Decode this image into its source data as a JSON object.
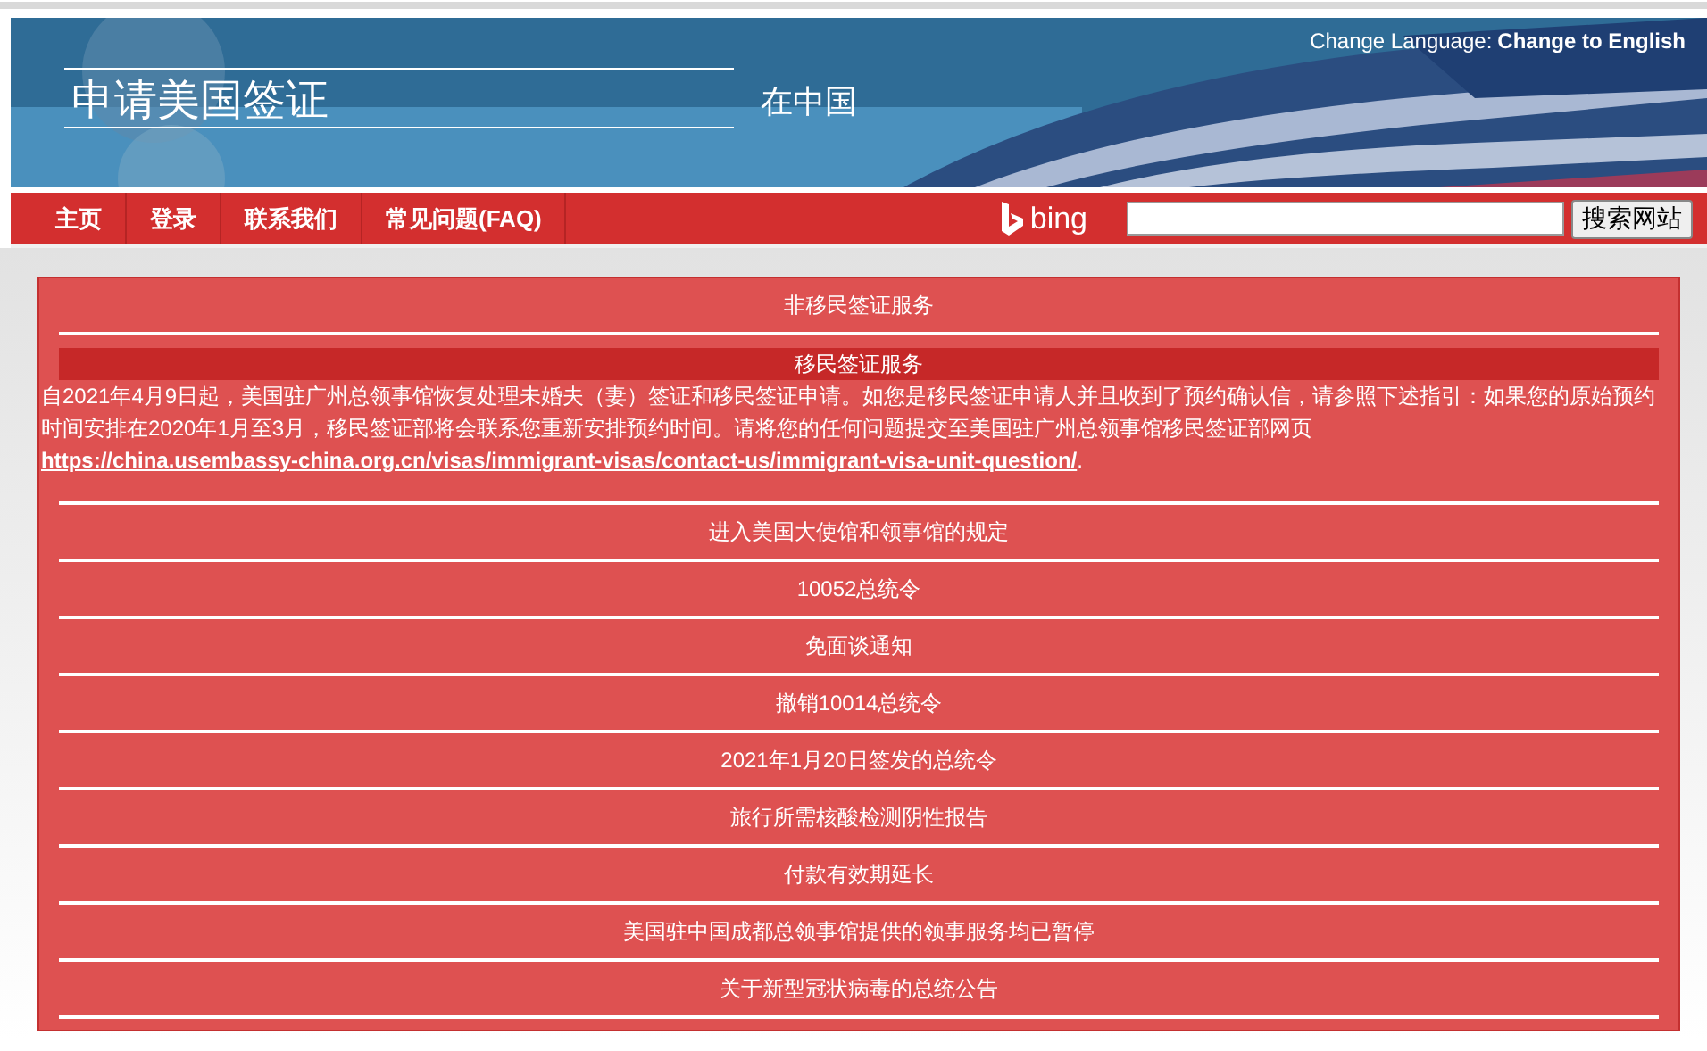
{
  "header": {
    "title": "申请美国签证",
    "subtitle": "在中国",
    "language_label": "Change Language:",
    "language_link": "Change to English"
  },
  "nav": {
    "items": [
      {
        "label": "主页"
      },
      {
        "label": "登录"
      },
      {
        "label": "联系我们"
      },
      {
        "label": "常见问题(FAQ)"
      }
    ],
    "search_brand": "bing",
    "search_button": "搜索网站"
  },
  "sections": [
    {
      "title": "非移民签证服务",
      "expanded": false
    },
    {
      "title": "移民签证服务",
      "expanded": true,
      "body": "自2021年4月9日起，美国驻广州总领事馆恢复处理未婚夫（妻）签证和移民签证申请。如您是移民签证申请人并且收到了预约确认信，请参照下述指引：如果您的原始预约时间安排在2020年1月至3月，移民签证部将会联系您重新安排预约时间。请将您的任何问题提交至美国驻广州总领事馆移民签证部网页",
      "link": "https://china.usembassy-china.org.cn/visas/immigrant-visas/contact-us/immigrant-visa-unit-question/",
      "body_end": "."
    },
    {
      "title": "进入美国大使馆和领事馆的规定",
      "expanded": false
    },
    {
      "title": "10052总统令",
      "expanded": false
    },
    {
      "title": "免面谈通知",
      "expanded": false
    },
    {
      "title": "撤销10014总统令",
      "expanded": false
    },
    {
      "title": "2021年1月20日签发的总统令",
      "expanded": false
    },
    {
      "title": "旅行所需核酸检测阴性报告",
      "expanded": false
    },
    {
      "title": "付款有效期延长",
      "expanded": false
    },
    {
      "title": "美国驻中国成都总领事馆提供的领事服务均已暂停",
      "expanded": false
    },
    {
      "title": "关于新型冠状病毒的总统公告",
      "expanded": false
    }
  ]
}
